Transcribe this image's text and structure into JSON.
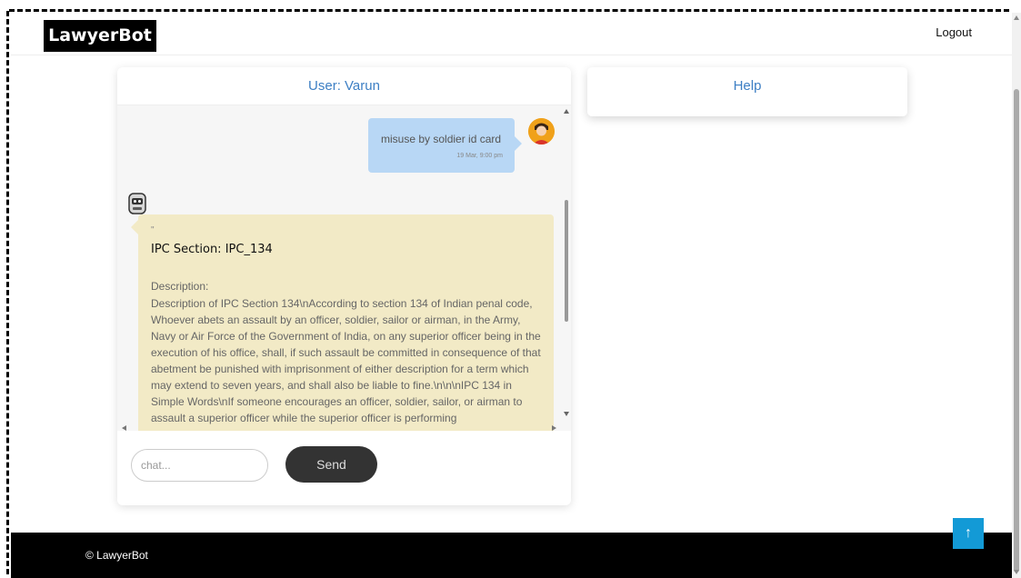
{
  "navbar": {
    "brand": "LawyerBot",
    "logout_label": "Logout"
  },
  "chat": {
    "header": "User: Varun",
    "user_message": {
      "text": "misuse by soldier id card",
      "time": "19 Mar, 9:00 pm"
    },
    "bot_message": {
      "quote": "\"",
      "title": "IPC Section: IPC_134",
      "description_label": "Description:",
      "description": "Description of IPC Section 134\\nAccording to section 134 of Indian penal code, Whoever abets an assault by an officer, soldier, sailor or airman, in the Army, Navy or Air Force of the Government of India, on any superior officer being in the execution of his office, shall, if such assault be committed in consequence of that abetment be punished with imprisonment of either description for a term which may extend to seven years, and shall also be liable to fine.\\n\\n\\nIPC 134 in Simple Words\\nIf someone encourages an officer, soldier, sailor, or airman to assault a superior officer while the superior officer is performing"
    },
    "input": {
      "placeholder": "chat...",
      "value": ""
    },
    "send_label": "Send"
  },
  "help": {
    "header": "Help"
  },
  "footer": {
    "copyright": "© LawyerBot"
  },
  "scroll_top_icon": "↑",
  "colors": {
    "accent": "#3d7fc4",
    "user_bubble": "#b8d7f5",
    "bot_bubble": "#f2eac6",
    "send_button": "#333333",
    "scroll_top_button": "#139ad6",
    "footer": "#000000"
  }
}
